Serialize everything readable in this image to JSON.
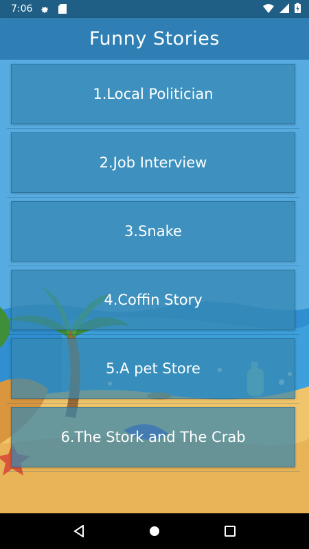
{
  "status_bar": {
    "time": "7:06",
    "icons": [
      "gear-icon",
      "sd-card-icon",
      "wifi-icon",
      "signal-icon",
      "battery-icon"
    ]
  },
  "app_bar": {
    "title": "Funny Stories"
  },
  "stories": [
    {
      "label": "1.Local Politician"
    },
    {
      "label": "2.Job Interview"
    },
    {
      "label": "3.Snake"
    },
    {
      "label": "4.Coffin Story"
    },
    {
      "label": "5.A pet Store"
    },
    {
      "label": "6.The Stork and The Crab"
    }
  ],
  "nav_bar": {
    "buttons": [
      "back-icon",
      "home-icon",
      "recents-icon"
    ]
  },
  "colors": {
    "status_bar": "#1f5f86",
    "app_bar": "#2f7fb4",
    "background": "#56ace0",
    "card": "#3586b0"
  }
}
